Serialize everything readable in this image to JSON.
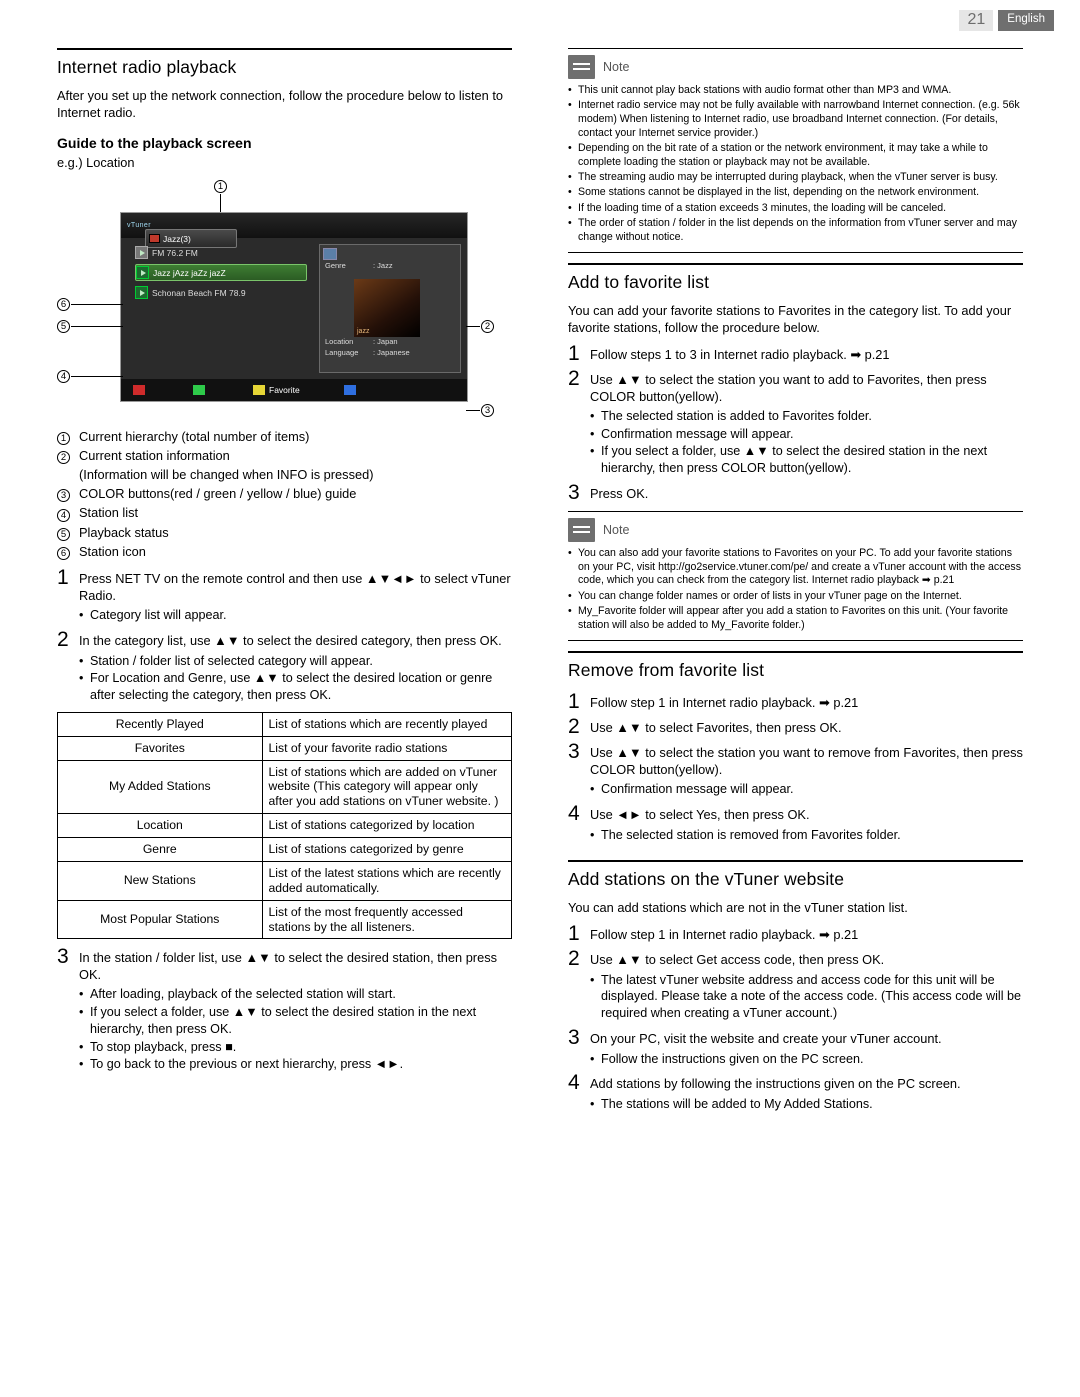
{
  "header": {
    "page_number": "21",
    "language": "English"
  },
  "left": {
    "title": "Internet radio playback",
    "intro": "After you set up the network connection, follow the procedure below to listen to Internet radio.",
    "guide_title": "Guide to the playback screen",
    "eg": "e.g.) Location",
    "screen": {
      "brand": "vTuner",
      "hierarchy": "Jazz(3)",
      "list": [
        {
          "label": "FM 76.2 FM",
          "selected": false
        },
        {
          "label": "Jazz jAzz jaZz jazZ",
          "selected": true
        },
        {
          "label": "Schonan Beach FM 78.9",
          "selected": false
        }
      ],
      "info": [
        {
          "key": "Genre",
          "value": ": Jazz"
        },
        {
          "key": "Location",
          "value": ": Japan"
        },
        {
          "key": "Language",
          "value": ": Japanese"
        }
      ],
      "album_text": "jazz",
      "favorite_label": "Favorite",
      "callouts": [
        "1",
        "2",
        "3",
        "4",
        "5",
        "6"
      ]
    },
    "legend": [
      {
        "num": "1",
        "text": "Current hierarchy (total number of items)"
      },
      {
        "num": "2",
        "text": "Current station information"
      },
      {
        "num": "2b",
        "text": "(Information will be changed when INFO is pressed)"
      },
      {
        "num": "3",
        "text": "COLOR buttons(red / green / yellow / blue) guide"
      },
      {
        "num": "4",
        "text": "Station list"
      },
      {
        "num": "5",
        "text": "Playback status"
      },
      {
        "num": "6",
        "text": "Station icon"
      }
    ],
    "steps": [
      {
        "n": "1",
        "text": "Press NET TV on the remote control and then use ▲▼◄► to select vTuner Radio.",
        "bullets": [
          "Category list will appear."
        ]
      },
      {
        "n": "2",
        "text": "In the category list, use ▲▼ to select the desired category, then press OK.",
        "bullets": [
          "Station / folder list of selected category will appear.",
          "For Location and Genre, use ▲▼ to select the desired location or genre after selecting the category, then press OK."
        ]
      },
      {
        "n": "3",
        "text": "In the station / folder list, use ▲▼ to select the desired station, then press OK.",
        "bullets": [
          "After loading, playback of the selected station will start.",
          "If you select a folder, use ▲▼ to select the desired station in the next hierarchy, then press OK.",
          "To stop playback, press ■.",
          "To go back to the previous or next hierarchy, press ◄►."
        ]
      }
    ],
    "category_table": [
      {
        "name": "Recently Played",
        "desc": "List of stations which are recently played"
      },
      {
        "name": "Favorites",
        "desc": "List of your favorite radio stations"
      },
      {
        "name": "My Added Stations",
        "desc": "List of stations which are added on vTuner website (This category will appear only after you add stations on vTuner website. )"
      },
      {
        "name": "Location",
        "desc": "List of stations categorized by location"
      },
      {
        "name": "Genre",
        "desc": "List of stations categorized by genre"
      },
      {
        "name": "New Stations",
        "desc": "List of the latest stations which are recently added automatically."
      },
      {
        "name": "Most Popular Stations",
        "desc": "List of the most frequently accessed stations by the all listeners."
      }
    ]
  },
  "right": {
    "note1": {
      "title": "Note",
      "items": [
        "This unit cannot play back stations with audio format other than MP3 and WMA.",
        "Internet radio service may not be fully available with narrowband Internet connection. (e.g. 56k modem) When listening to Internet radio, use broadband Internet connection. (For details, contact your Internet service provider.)",
        "Depending on the bit rate of a station or the network environment, it may take a while to complete loading the station or playback may not be available.",
        "The streaming audio may be interrupted during playback, when the vTuner server is busy.",
        "Some stations cannot be displayed in the list, depending on the network environment.",
        "If the loading time of a station exceeds 3 minutes, the loading will be canceled.",
        "The order of station / folder in the list depends on the information from vTuner server and may change without notice."
      ]
    },
    "fav": {
      "title": "Add to favorite list",
      "intro": "You can add your favorite stations to Favorites in the category list. To add your favorite stations, follow the procedure below.",
      "steps": [
        {
          "n": "1",
          "text": "Follow steps 1 to 3 in Internet radio playback. ➡ p.21",
          "bullets": []
        },
        {
          "n": "2",
          "text": "Use ▲▼ to select the station you want to add to Favorites, then press COLOR button(yellow).",
          "bullets": [
            "The selected station is added to Favorites folder.",
            "Confirmation message will appear.",
            "If you select a folder, use ▲▼ to select the desired station in the next hierarchy, then press COLOR button(yellow)."
          ]
        },
        {
          "n": "3",
          "text": "Press OK.",
          "bullets": []
        }
      ]
    },
    "note2": {
      "title": "Note",
      "items": [
        "You can also add your favorite stations to Favorites on your PC. To add your favorite stations on your PC, visit http://go2service.vtuner.com/pe/ and create a vTuner account with the access code, which you can check from the category list. Internet radio playback ➡ p.21",
        "You can change folder names or order of lists in your vTuner page on the Internet.",
        "My_Favorite folder will appear after you add a station to Favorites on this unit. (Your favorite station will also be added to My_Favorite folder.)"
      ]
    },
    "remove": {
      "title": "Remove from favorite list",
      "steps": [
        {
          "n": "1",
          "text": "Follow step 1 in Internet radio playback. ➡ p.21",
          "bullets": []
        },
        {
          "n": "2",
          "text": "Use ▲▼ to select Favorites, then press OK.",
          "bullets": []
        },
        {
          "n": "3",
          "text": "Use ▲▼ to select the station you want to remove from Favorites, then press COLOR button(yellow).",
          "bullets": [
            "Confirmation message will appear."
          ]
        },
        {
          "n": "4",
          "text": "Use ◄► to select Yes, then press OK.",
          "bullets": [
            "The selected station is removed from Favorites folder."
          ]
        }
      ]
    },
    "addweb": {
      "title": "Add stations on the vTuner website",
      "intro": "You can add stations which are not in the vTuner station list.",
      "steps": [
        {
          "n": "1",
          "text": "Follow step 1 in Internet radio playback. ➡ p.21",
          "bullets": []
        },
        {
          "n": "2",
          "text": "Use ▲▼ to select Get access code, then press OK.",
          "bullets": [
            "The latest vTuner website address and access code for this unit will be displayed. Please take a note of the access code. (This access code will be required when creating a vTuner account.)"
          ]
        },
        {
          "n": "3",
          "text": "On your PC, visit the website and create your vTuner account.",
          "bullets": [
            "Follow the instructions given on the PC screen."
          ]
        },
        {
          "n": "4",
          "text": "Add stations by following the instructions given on the PC screen.",
          "bullets": [
            "The stations will be added to My Added Stations."
          ]
        }
      ]
    }
  }
}
